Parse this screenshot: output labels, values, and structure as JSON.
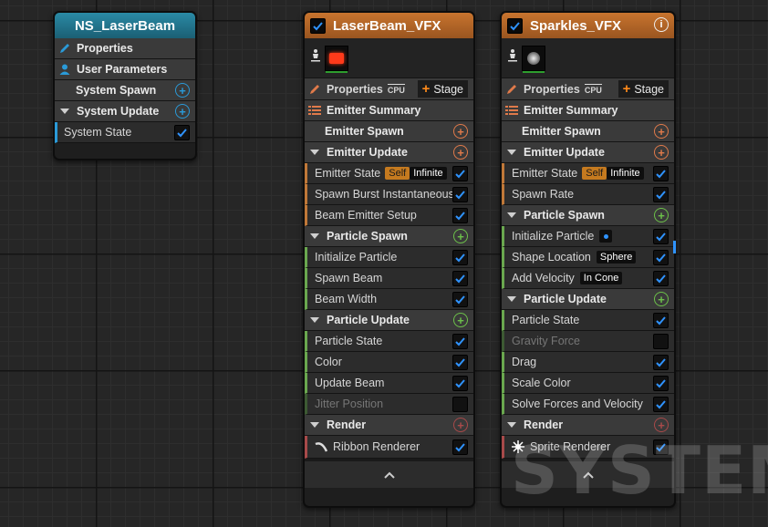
{
  "system_node": {
    "title": "NS_LaserBeam",
    "header_color": "#1f6f86",
    "properties_label": "Properties",
    "user_parameters_label": "User Parameters",
    "system_spawn_label": "System Spawn",
    "system_update_label": "System Update",
    "system_state_label": "System State"
  },
  "laser_emitter": {
    "title": "LaserBeam_VFX",
    "header_color": "#b5662a",
    "properties_label": "Properties",
    "cpu_label": "CPU",
    "stage_label": "Stage",
    "emitter_summary_label": "Emitter Summary",
    "emitter_spawn_label": "Emitter Spawn",
    "emitter_update_label": "Emitter Update",
    "emitter_update_items": [
      {
        "label": "Emitter State",
        "chip_self": "Self",
        "chip_value": "Infinite",
        "checked": true
      },
      {
        "label": "Spawn Burst Instantaneous",
        "checked": true
      },
      {
        "label": "Beam Emitter Setup",
        "checked": true
      }
    ],
    "particle_spawn_label": "Particle Spawn",
    "particle_spawn_items": [
      {
        "label": "Initialize Particle",
        "checked": true
      },
      {
        "label": "Spawn Beam",
        "checked": true
      },
      {
        "label": "Beam Width",
        "checked": true
      }
    ],
    "particle_update_label": "Particle Update",
    "particle_update_items": [
      {
        "label": "Particle State",
        "checked": true
      },
      {
        "label": "Color",
        "checked": true
      },
      {
        "label": "Update Beam",
        "checked": true
      },
      {
        "label": "Jitter Position",
        "checked": false
      }
    ],
    "render_label": "Render",
    "renderer_label": "Ribbon Renderer"
  },
  "sparkles_emitter": {
    "title": "Sparkles_VFX",
    "header_color": "#b5662a",
    "properties_label": "Properties",
    "cpu_label": "CPU",
    "stage_label": "Stage",
    "emitter_summary_label": "Emitter Summary",
    "emitter_spawn_label": "Emitter Spawn",
    "emitter_update_label": "Emitter Update",
    "emitter_update_items": [
      {
        "label": "Emitter State",
        "chip_self": "Self",
        "chip_value": "Infinite",
        "checked": true
      },
      {
        "label": "Spawn Rate",
        "checked": true
      }
    ],
    "particle_spawn_label": "Particle Spawn",
    "particle_spawn_items": [
      {
        "label": "Initialize Particle",
        "checked": true
      },
      {
        "label": "Shape Location",
        "chip_value": "Sphere",
        "checked": true
      },
      {
        "label": "Add Velocity",
        "chip_value": "In Cone",
        "checked": true
      }
    ],
    "particle_update_label": "Particle Update",
    "particle_update_items": [
      {
        "label": "Particle State",
        "checked": true
      },
      {
        "label": "Gravity Force",
        "checked": false
      },
      {
        "label": "Drag",
        "checked": true
      },
      {
        "label": "Scale Color",
        "checked": true
      },
      {
        "label": "Solve Forces and Velocity",
        "checked": true
      }
    ],
    "render_label": "Render",
    "renderer_label": "Sprite Renderer"
  },
  "watermark": "SYSTEM",
  "colors": {
    "accent_blue": "#1e88e5",
    "system_plus": "#2a9ad8",
    "emitter_plus": "#e07a4a",
    "particle_plus": "#6cc04a",
    "emitter_stripe": "#c07838",
    "particle_stripe": "#6aa84f",
    "render_stripe": "#a84a4a"
  }
}
